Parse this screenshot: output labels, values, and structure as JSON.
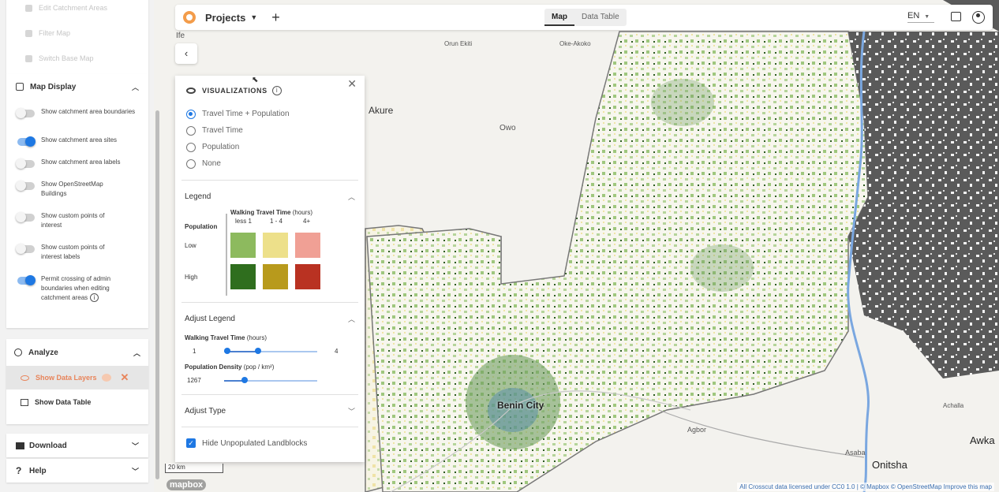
{
  "sidebar": {
    "faded_items": [
      "Edit Catchment Areas",
      "Filter Map",
      "Switch Base Map"
    ],
    "map_display": {
      "title": "Map Display",
      "toggles": [
        {
          "label": "Show catchment area boundaries",
          "on": false
        },
        {
          "label": "Show catchment area sites",
          "on": true
        },
        {
          "label": "Show catchment area labels",
          "on": false
        },
        {
          "label": "Show OpenStreetMap Buildings",
          "on": false
        },
        {
          "label": "Show custom points of interest",
          "on": false
        },
        {
          "label": "Show custom points of interest labels",
          "on": false
        },
        {
          "label": "Permit crossing of admin boundaries when editing catchment areas",
          "on": true
        }
      ]
    },
    "analyze": {
      "title": "Analyze",
      "show_data_layers": "Show Data Layers",
      "show_data_table": "Show Data Table"
    },
    "download": "Download",
    "help": "Help"
  },
  "topbar": {
    "projects": "Projects",
    "plus": "+",
    "tabs": [
      "Map",
      "Data Table"
    ],
    "language": "EN"
  },
  "visualizations": {
    "title": "VISUALIZATIONS",
    "options": [
      "Travel Time + Population",
      "Travel Time",
      "Population",
      "None"
    ],
    "legend": {
      "title": "Legend",
      "population_label": "Population",
      "travel_time_label": "Walking Travel Time",
      "travel_time_unit": "(hours)",
      "columns": [
        "less 1",
        "1 - 4",
        "4+"
      ],
      "rows": [
        "Low",
        "High"
      ],
      "colors": [
        [
          "#8dba5e",
          "#ede08a",
          "#f0a095"
        ],
        [
          "#2f6e1e",
          "#b89a1c",
          "#b93222"
        ]
      ]
    },
    "adjust_legend": {
      "title": "Adjust Legend",
      "travel_label": "Walking Travel Time",
      "travel_unit": "(hours)",
      "travel_min": "1",
      "travel_max": "4",
      "density_label": "Population Density",
      "density_unit": "(pop / km²)",
      "density_value": "1267"
    },
    "adjust_type": "Adjust Type",
    "hide_unpopulated": "Hide Unpopulated Landblocks"
  },
  "map": {
    "labels": {
      "ife": "Ife",
      "orun_ekiti": "Orun Ekiti",
      "oke_akoko": "Oke-Akoko",
      "akure": "Akure",
      "owo": "Owo",
      "benin_city": "Benin City",
      "agbor": "Agbor",
      "achalla": "Achalla",
      "awka": "Awka",
      "asaba": "Asaba",
      "onitsha": "Onitsha"
    },
    "scale": "20 km",
    "mapbox": "mapbox",
    "attribution": "All Crosscut data licensed under CC0 1.0 | © Mapbox © OpenStreetMap Improve this map"
  }
}
